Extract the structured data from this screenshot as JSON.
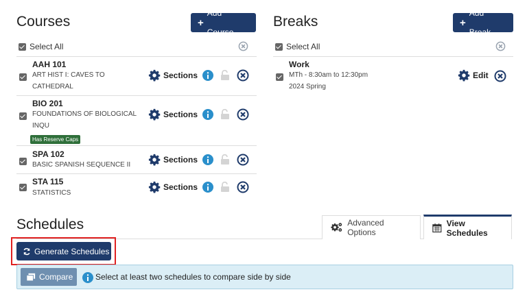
{
  "courses": {
    "heading": "Courses",
    "add_label": "Add Course",
    "select_all": "Select All",
    "items": [
      {
        "code": "AAH 101",
        "title_lines": [
          "ART HIST I: CAVES TO",
          "CATHEDRAL"
        ],
        "badge": "",
        "action": "Sections"
      },
      {
        "code": "BIO 201",
        "title_lines": [
          "FOUNDATIONS OF BIOLOGICAL",
          "INQU"
        ],
        "badge": "Has Reserve Caps",
        "action": "Sections"
      },
      {
        "code": "SPA 102",
        "title_lines": [
          "BASIC SPANISH SEQUENCE II"
        ],
        "badge": "",
        "action": "Sections"
      },
      {
        "code": "STA 115",
        "title_lines": [
          "STATISTICS"
        ],
        "badge": "",
        "action": "Sections"
      }
    ]
  },
  "breaks": {
    "heading": "Breaks",
    "add_label": "Add Break",
    "select_all": "Select All",
    "items": [
      {
        "name": "Work",
        "time": "MTh - 8:30am to 12:30pm",
        "term": "2024 Spring",
        "action": "Edit"
      }
    ]
  },
  "schedules": {
    "heading": "Schedules",
    "tabs": [
      {
        "label": "Advanced Options",
        "icon": "gears-icon",
        "active": false
      },
      {
        "label": "View Schedules",
        "icon": "calendar-icon",
        "active": true
      }
    ],
    "generate_label": "Generate Schedules",
    "compare_label": "Compare",
    "info_text": "Select at least two schedules to compare side by side"
  },
  "colors": {
    "primary": "#1f3b6b",
    "info_icon": "#2a8fcb",
    "highlight": "#e02020",
    "badge": "#2f6f3a"
  }
}
